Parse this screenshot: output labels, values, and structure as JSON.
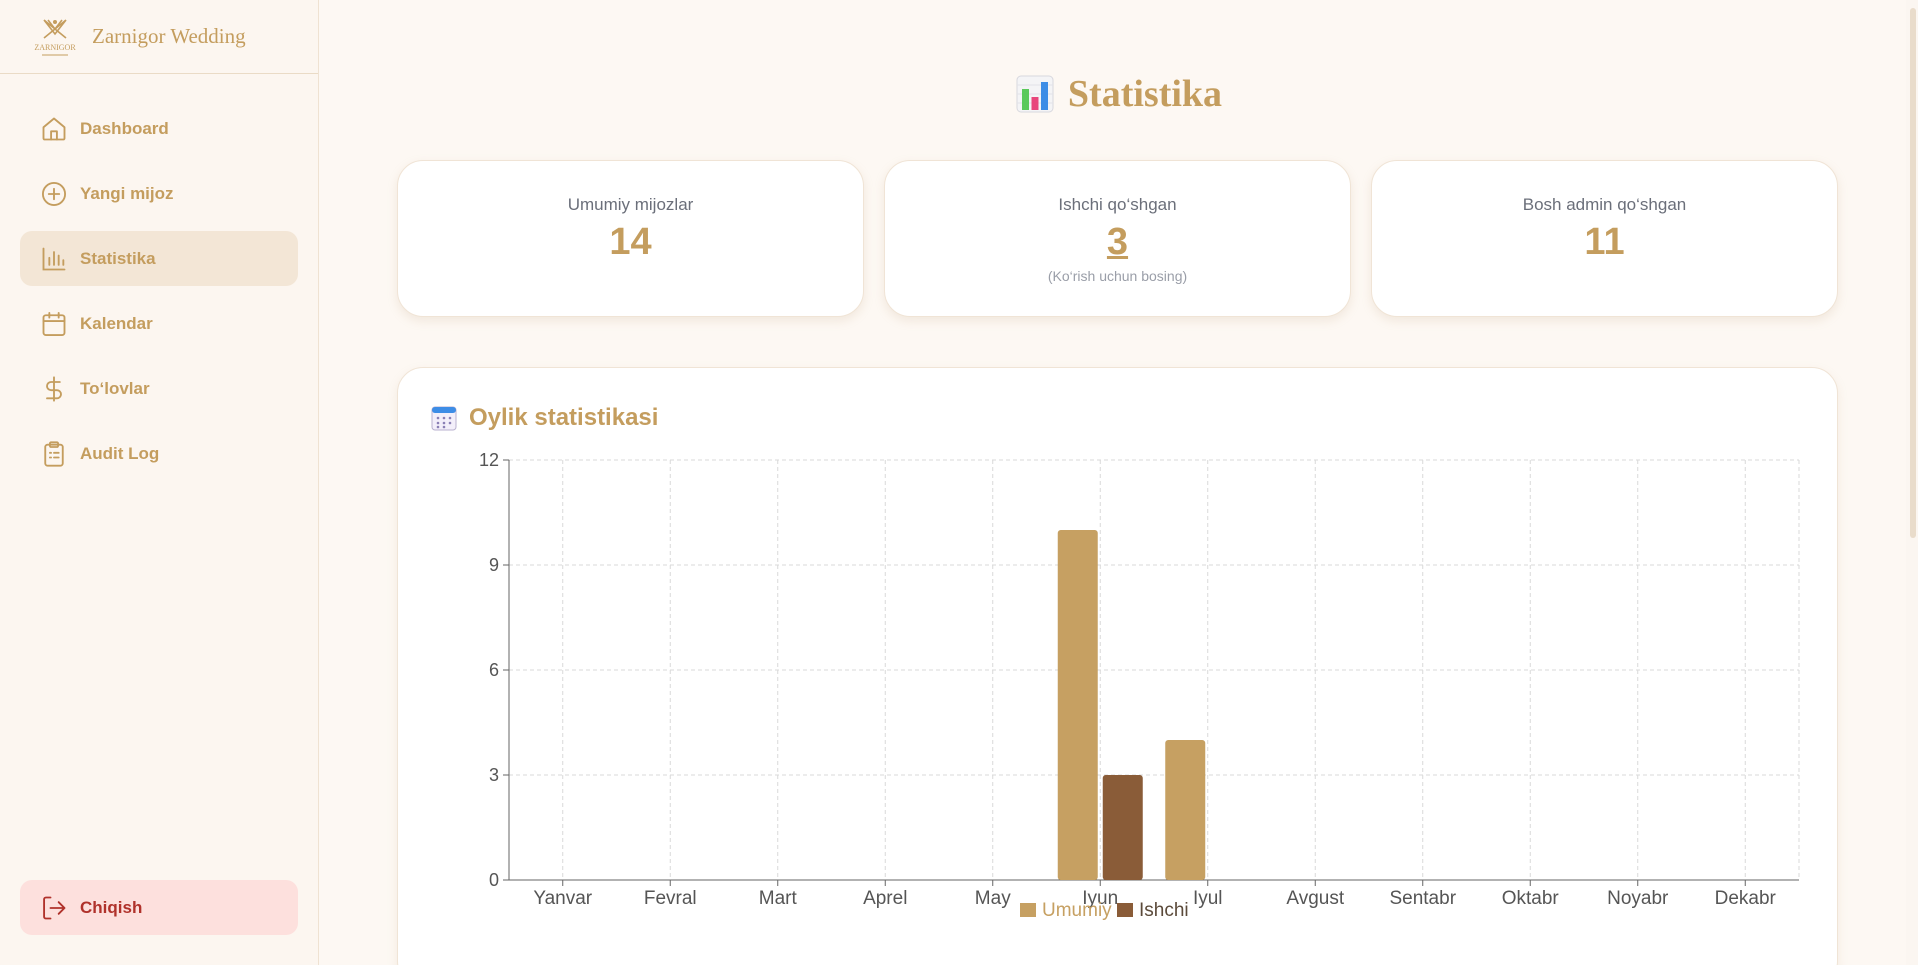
{
  "brand": {
    "logo_text": "ZARNIGOR",
    "name": "Zarnigor Wedding"
  },
  "sidebar": {
    "items": [
      {
        "label": "Dashboard",
        "icon": "home-icon",
        "active": false
      },
      {
        "label": "Yangi mijoz",
        "icon": "plus-circle-icon",
        "active": false
      },
      {
        "label": "Statistika",
        "icon": "bar-chart-icon",
        "active": true
      },
      {
        "label": "Kalendar",
        "icon": "calendar-icon",
        "active": false
      },
      {
        "label": "To‘lovlar",
        "icon": "dollar-icon",
        "active": false
      },
      {
        "label": "Audit Log",
        "icon": "clipboard-icon",
        "active": false
      }
    ],
    "logout_label": "Chiqish"
  },
  "page": {
    "title": "Statistika"
  },
  "stats": {
    "total_clients": {
      "label": "Umumiy mijozlar",
      "value": "14"
    },
    "worker_added": {
      "label": "Ishchi qo‘shgan",
      "value": "3",
      "hint": "(Ko‘rish uchun bosing)"
    },
    "admin_added": {
      "label": "Bosh admin qo‘shgan",
      "value": "11"
    }
  },
  "chart_section": {
    "heading": "Oylik statistikasi"
  },
  "colors": {
    "accent": "#c49d5e",
    "umumiy": "#c6a062",
    "ishchi": "#8a5c38",
    "logout_bg": "#fde0dd",
    "logout_text": "#b0322b"
  },
  "chart_data": {
    "type": "bar",
    "categories": [
      "Yanvar",
      "Fevral",
      "Mart",
      "Aprel",
      "May",
      "Iyun",
      "Iyul",
      "Avgust",
      "Sentabr",
      "Oktabr",
      "Noyabr",
      "Dekabr"
    ],
    "series": [
      {
        "name": "Umumiy",
        "values": [
          0,
          0,
          0,
          0,
          0,
          10,
          4,
          0,
          0,
          0,
          0,
          0
        ]
      },
      {
        "name": "Ishchi",
        "values": [
          0,
          0,
          0,
          0,
          0,
          3,
          0,
          0,
          0,
          0,
          0,
          0
        ]
      }
    ],
    "ylim": [
      0,
      12
    ],
    "yticks": [
      0,
      3,
      6,
      9,
      12
    ],
    "grid": true,
    "legend": "bottom-center"
  }
}
